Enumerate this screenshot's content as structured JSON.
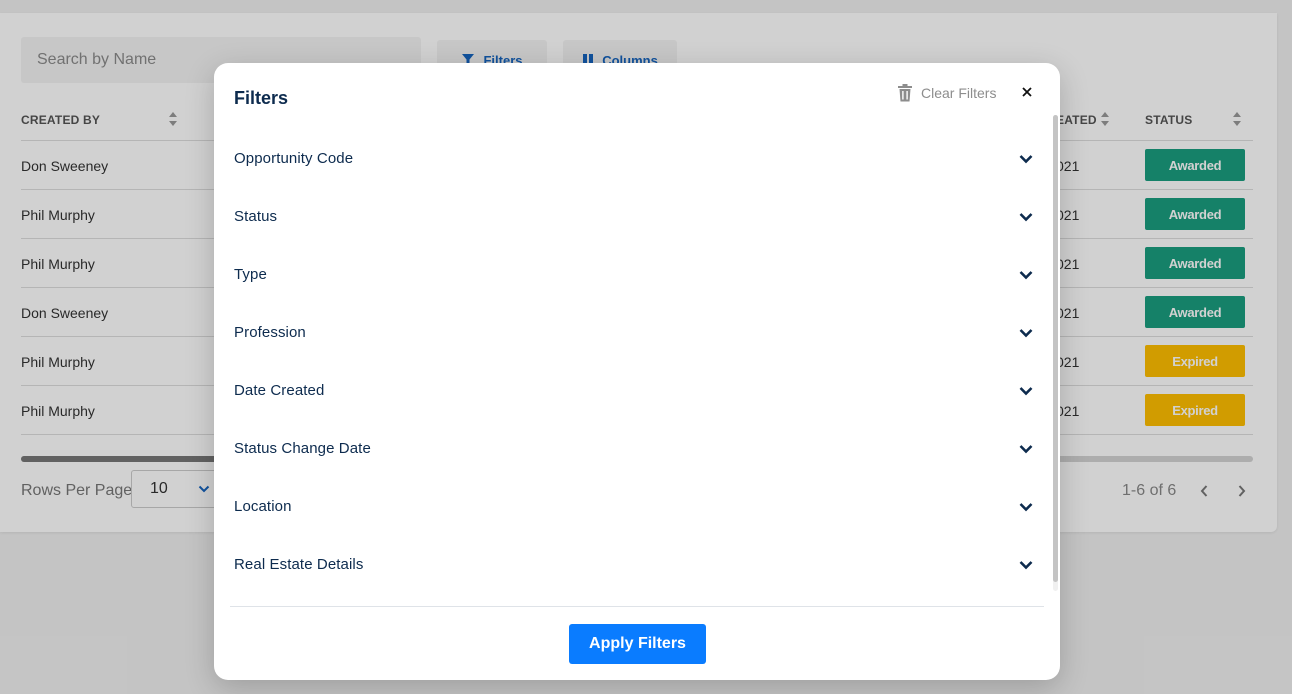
{
  "background": {
    "search": {
      "placeholder": "Search by Name"
    },
    "toolbar": {
      "filters_label": "Filters",
      "columns_label": "Columns"
    },
    "table": {
      "headers": {
        "created_by": "CREATED BY",
        "date_created_partial": "EATED",
        "status": "STATUS"
      },
      "rows": [
        {
          "created_by": "Don Sweeney",
          "date_partial": "021",
          "status": "Awarded"
        },
        {
          "created_by": "Phil Murphy",
          "date_partial": "021",
          "status": "Awarded"
        },
        {
          "created_by": "Phil Murphy",
          "date_partial": "021",
          "status": "Awarded"
        },
        {
          "created_by": "Don Sweeney",
          "date_partial": "021",
          "status": "Awarded"
        },
        {
          "created_by": "Phil Murphy",
          "date_partial": "021",
          "status": "Expired"
        },
        {
          "created_by": "Phil Murphy",
          "date_partial": "021",
          "status": "Expired"
        }
      ]
    },
    "pagination": {
      "rows_per_page_label": "Rows Per Page",
      "rows_per_page_value": "10",
      "range_text": "1-6 of 6"
    }
  },
  "modal": {
    "title": "Filters",
    "clear_label": "Clear Filters",
    "sections": [
      {
        "label": "Opportunity Code"
      },
      {
        "label": "Status"
      },
      {
        "label": "Type"
      },
      {
        "label": "Profession"
      },
      {
        "label": "Date Created"
      },
      {
        "label": "Status Change Date"
      },
      {
        "label": "Location"
      },
      {
        "label": "Real Estate Details"
      }
    ],
    "apply_label": "Apply Filters"
  },
  "colors": {
    "accent": "#0a7cff",
    "title_text": "#0d2b4e",
    "awarded": "#1a9e7f",
    "expired": "#ffbf00",
    "toolbar_link": "#1565c0"
  },
  "icons": {
    "clear": "trash-icon",
    "close": "close-icon",
    "section_toggle": "chevron-down-icon",
    "filters": "filter-icon",
    "columns": "columns-icon"
  }
}
